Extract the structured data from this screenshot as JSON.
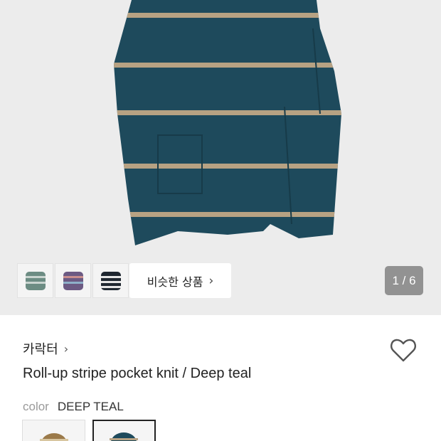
{
  "gallery": {
    "similar_button": {
      "label": "비슷한 상품",
      "chevron": "›"
    },
    "page_counter": "1 / 6",
    "thumbnails": [
      "thumb-green-knit",
      "thumb-purple-knit",
      "thumb-navy-stripe-knit"
    ]
  },
  "product": {
    "brand": "카락터",
    "brand_chevron": "›",
    "title": "Roll-up stripe pocket knit / Deep teal",
    "color_label": "color",
    "color_value": "DEEP TEAL",
    "swatches": [
      "brown",
      "deep-teal"
    ]
  },
  "icons": {
    "wishlist": "heart-outline-icon"
  },
  "colors": {
    "knit_body": "#1e4a5c",
    "stripe": "#b7a283",
    "gallery_bg": "#ececec",
    "counter_bg": "#7a7a7a"
  }
}
